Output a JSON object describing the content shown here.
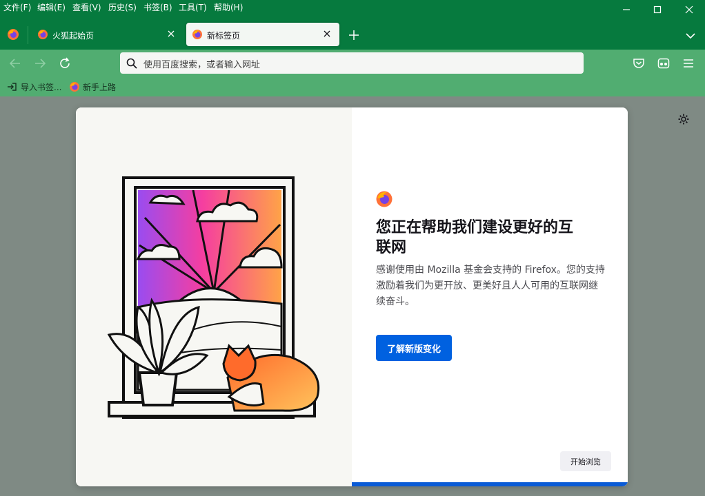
{
  "menu": [
    "文件(F)",
    "编辑(E)",
    "查看(V)",
    "历史(S)",
    "书签(B)",
    "工具(T)",
    "帮助(H)"
  ],
  "tabs": [
    {
      "title": "火狐起始页",
      "active": false
    },
    {
      "title": "新标签页",
      "active": true
    }
  ],
  "urlbar": {
    "placeholder": "使用百度搜索，或者输入网址"
  },
  "bookmarks": [
    {
      "label": "导入书签...",
      "icon": "import-icon"
    },
    {
      "label": "新手上路",
      "icon": "firefox-icon"
    }
  ],
  "dialog": {
    "headline": "您正在帮助我们建设更好的互联网",
    "body": "感谢使用由 Mozilla 基金会支持的 Firefox。您的支持激励着我们为更开放、更美好且人人可用的互联网继续奋斗。",
    "primary_label": "了解新版变化",
    "secondary_label": "开始浏览"
  },
  "colors": {
    "titlebar": "#067a3e",
    "toolbar": "#51ad71",
    "content_bg": "#7f8a84",
    "primary": "#0061e0"
  }
}
